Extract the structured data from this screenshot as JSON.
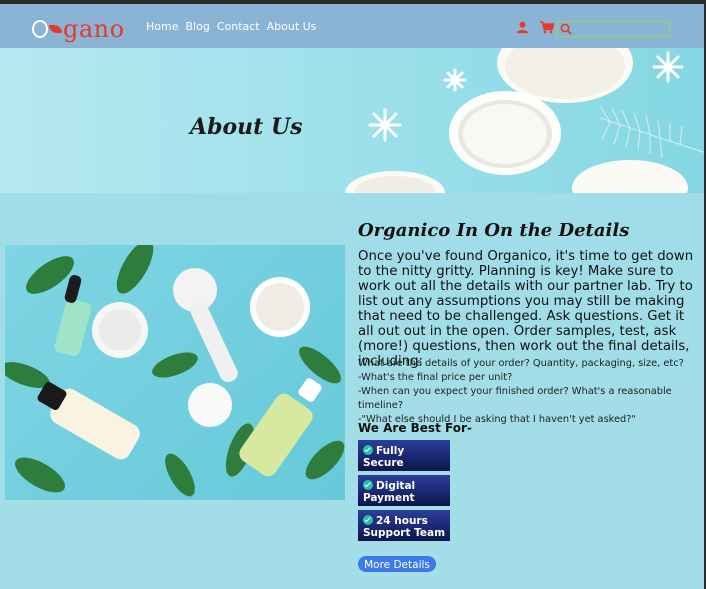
{
  "brand": {
    "logo_text": "gano",
    "logo_color": "#e53a26"
  },
  "nav": {
    "items": [
      "Home",
      "Blog",
      "Contact",
      "About Us"
    ],
    "icons": [
      "user-icon",
      "cart-icon",
      "search-icon"
    ],
    "search_placeholder": ""
  },
  "banner": {
    "title": "About Us"
  },
  "main": {
    "heading": "Organico In On the Details",
    "lead": "Once you've found Organico, it's time to get down to the nitty gritty. Planning is key! Make sure to work out all the details with our partner lab. Try to list out any assumptions you may still be making that need to be challenged. Ask questions. Get it all out out in the open. Order samples, test, ask (more!) questions, then work out the final details, including:",
    "details": [
      "What are the details of your order? Quantity, packaging, size, etc?",
      "-What's the final price per unit?",
      "-When can you expect your finished order? What's a reasonable timeline?",
      "-\"What else should I be asking that I haven't yet asked?\""
    ],
    "best_heading": "We Are Best For-",
    "features": [
      "Fully Secure",
      "Digital Payment",
      "24 hours Support Team"
    ],
    "more_button": "More Details"
  },
  "colors": {
    "nav_bg": "#8bb3d6",
    "page_bg": "#a9dde6",
    "feature_bg": "#1b2772",
    "button_bg": "#3b7ae8"
  }
}
